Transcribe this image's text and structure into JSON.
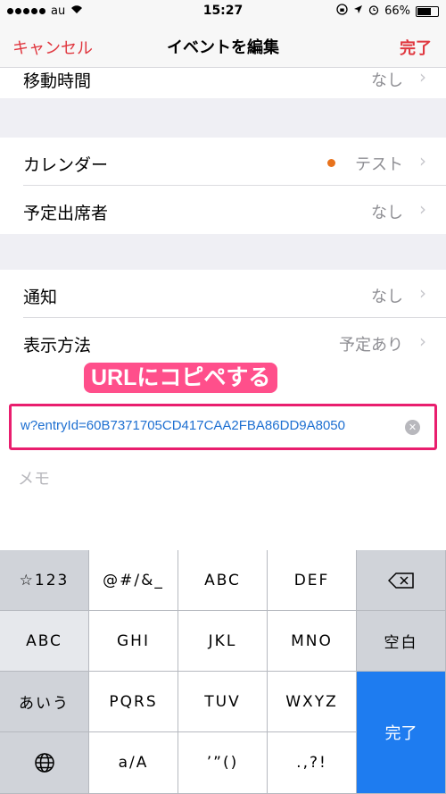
{
  "status_bar": {
    "carrier": "au",
    "time": "15:27",
    "battery_percent": "66%",
    "battery_level": 0.66,
    "signal_filled": 5,
    "signal_total": 5
  },
  "nav": {
    "cancel": "キャンセル",
    "title": "イベントを編集",
    "done": "完了"
  },
  "rows": {
    "travel_time": {
      "label": "移動時間",
      "value": "なし"
    },
    "calendar": {
      "label": "カレンダー",
      "value": "テスト",
      "dot_color": "#e8721c"
    },
    "invitees": {
      "label": "予定出席者",
      "value": "なし"
    },
    "alert": {
      "label": "通知",
      "value": "なし"
    },
    "show_as": {
      "label": "表示方法",
      "value": "予定あり"
    }
  },
  "url_field": {
    "value": "w?entryId=60B7371705CD417CAA2FBA86DD9A8050"
  },
  "notes": {
    "placeholder": "メモ"
  },
  "callout": {
    "text": "URLにコピペする",
    "color": "#ff4f8b"
  },
  "keyboard": {
    "row1": [
      "☆123",
      "@#/&_",
      "ABC",
      "DEF"
    ],
    "row2": [
      "ABC",
      "GHI",
      "JKL",
      "MNO",
      "空白"
    ],
    "row3": [
      "あいう",
      "PQRS",
      "TUV",
      "WXYZ"
    ],
    "row4": [
      "a/A",
      "’”()",
      ".,?!"
    ],
    "done": "完了"
  },
  "accent_color": "#e0373f",
  "link_color": "#1d6fd1"
}
